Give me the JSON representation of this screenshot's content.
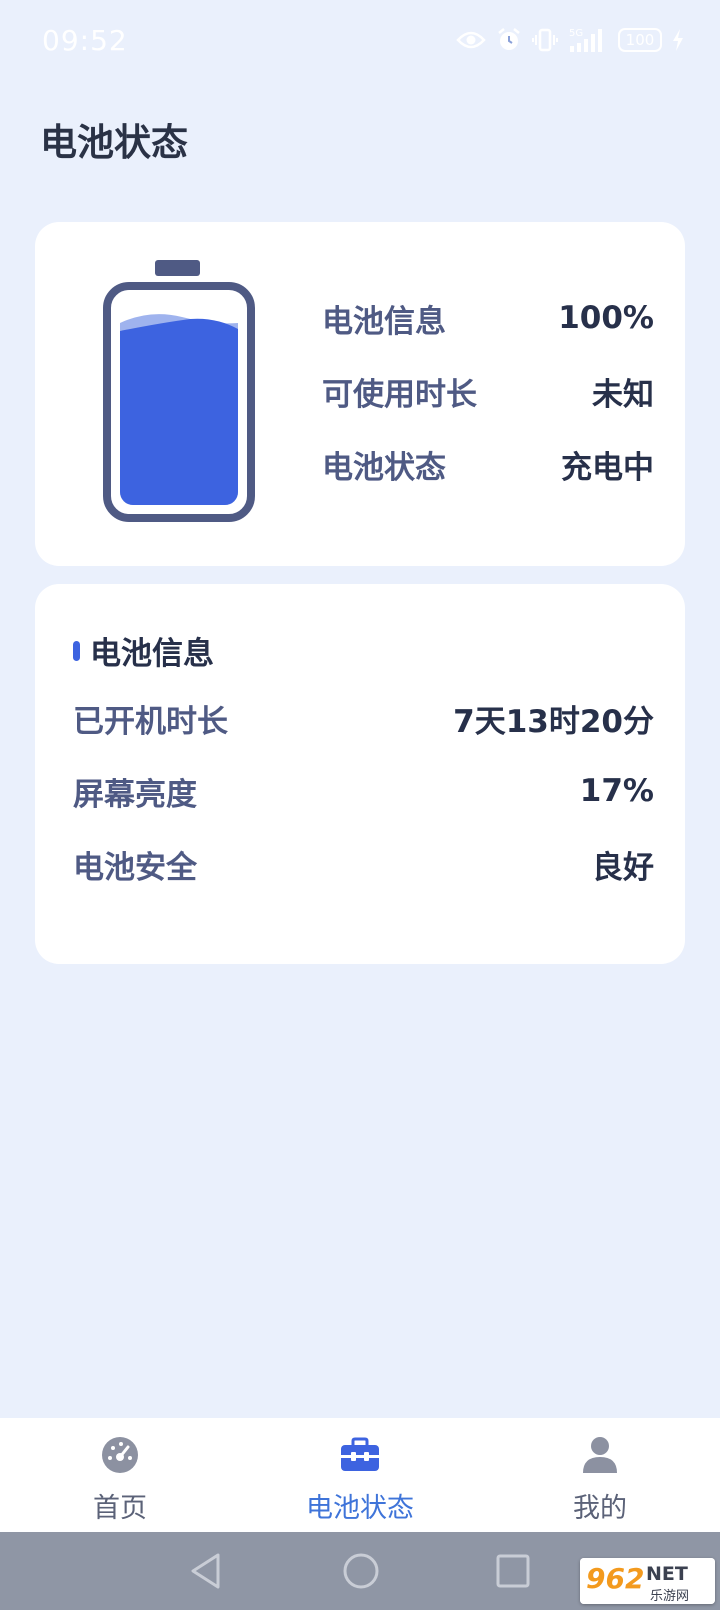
{
  "status_bar": {
    "time": "09:52",
    "battery_level": "100",
    "network": "5G",
    "icons": [
      "eye-icon",
      "alarm-icon",
      "vibrate-icon",
      "signal-5g-icon",
      "battery-icon",
      "charging-bolt-icon"
    ]
  },
  "page": {
    "title": "电池状态"
  },
  "overview": {
    "battery_fill_level": 1.0,
    "rows": [
      {
        "label": "电池信息",
        "value": "100%"
      },
      {
        "label": "可使用时长",
        "value": "未知"
      },
      {
        "label": "电池状态",
        "value": "充电中"
      }
    ]
  },
  "info_card": {
    "title": "电池信息",
    "rows": [
      {
        "label": "已开机时长",
        "value": "7天13时20分"
      },
      {
        "label": "屏幕亮度",
        "value": "17%"
      },
      {
        "label": "电池安全",
        "value": "良好"
      }
    ]
  },
  "bottom_nav": {
    "items": [
      {
        "label": "首页",
        "icon": "dashboard-icon",
        "active": false
      },
      {
        "label": "电池状态",
        "icon": "toolbox-icon",
        "active": true
      },
      {
        "label": "我的",
        "icon": "user-icon",
        "active": false
      }
    ]
  },
  "system_nav": {
    "icons": [
      "back-icon",
      "home-icon",
      "recents-icon"
    ]
  },
  "watermark": {
    "brand": "962",
    "suffix": "NET",
    "subtitle": "乐游网"
  },
  "colors": {
    "background": "#eaf0fc",
    "card": "#ffffff",
    "accent": "#3d63e0",
    "battery_outline": "#4f5a84",
    "active_tab": "#3f74d9"
  }
}
